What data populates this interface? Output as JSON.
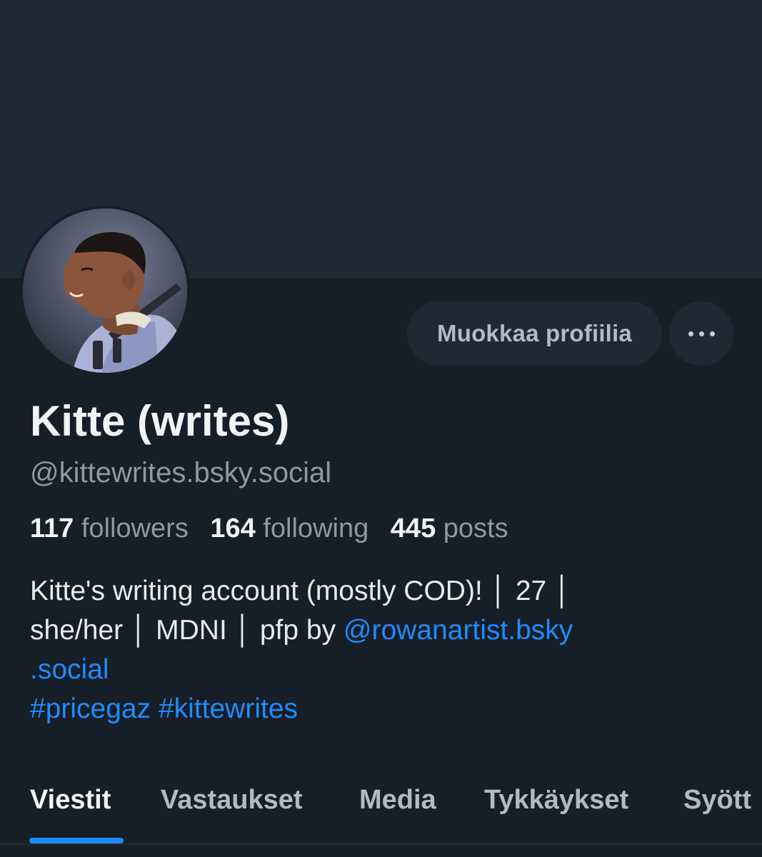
{
  "profile": {
    "display_name": "Kitte (writes)",
    "handle": "@kittewrites.bsky.social",
    "edit_button_label": "Muokkaa profiilia",
    "more_button_icon": "more-horizontal-icon"
  },
  "stats": {
    "followers_count": "117",
    "followers_label": "followers",
    "following_count": "164",
    "following_label": "following",
    "posts_count": "445",
    "posts_label": "posts"
  },
  "bio": {
    "line1": "Kitte's writing account (mostly COD)! │ 27 │",
    "line2_text": "she/her │ MDNI │ pfp by ",
    "mention_part1": "@rowanartist.bsky",
    "mention_part2": ".social",
    "hashtag1": "#pricegaz",
    "hashtag2": "#kittewrites"
  },
  "tabs": [
    {
      "label": "Viestit",
      "active": true
    },
    {
      "label": "Vastaukset",
      "active": false
    },
    {
      "label": "Media",
      "active": false
    },
    {
      "label": "Tykkäykset",
      "active": false
    },
    {
      "label": "Syött",
      "active": false
    }
  ],
  "colors": {
    "background": "#161e27",
    "banner": "#1e2936",
    "accent": "#208bfe",
    "text_primary": "#f1f3f5",
    "text_secondary": "#8d99a6"
  }
}
